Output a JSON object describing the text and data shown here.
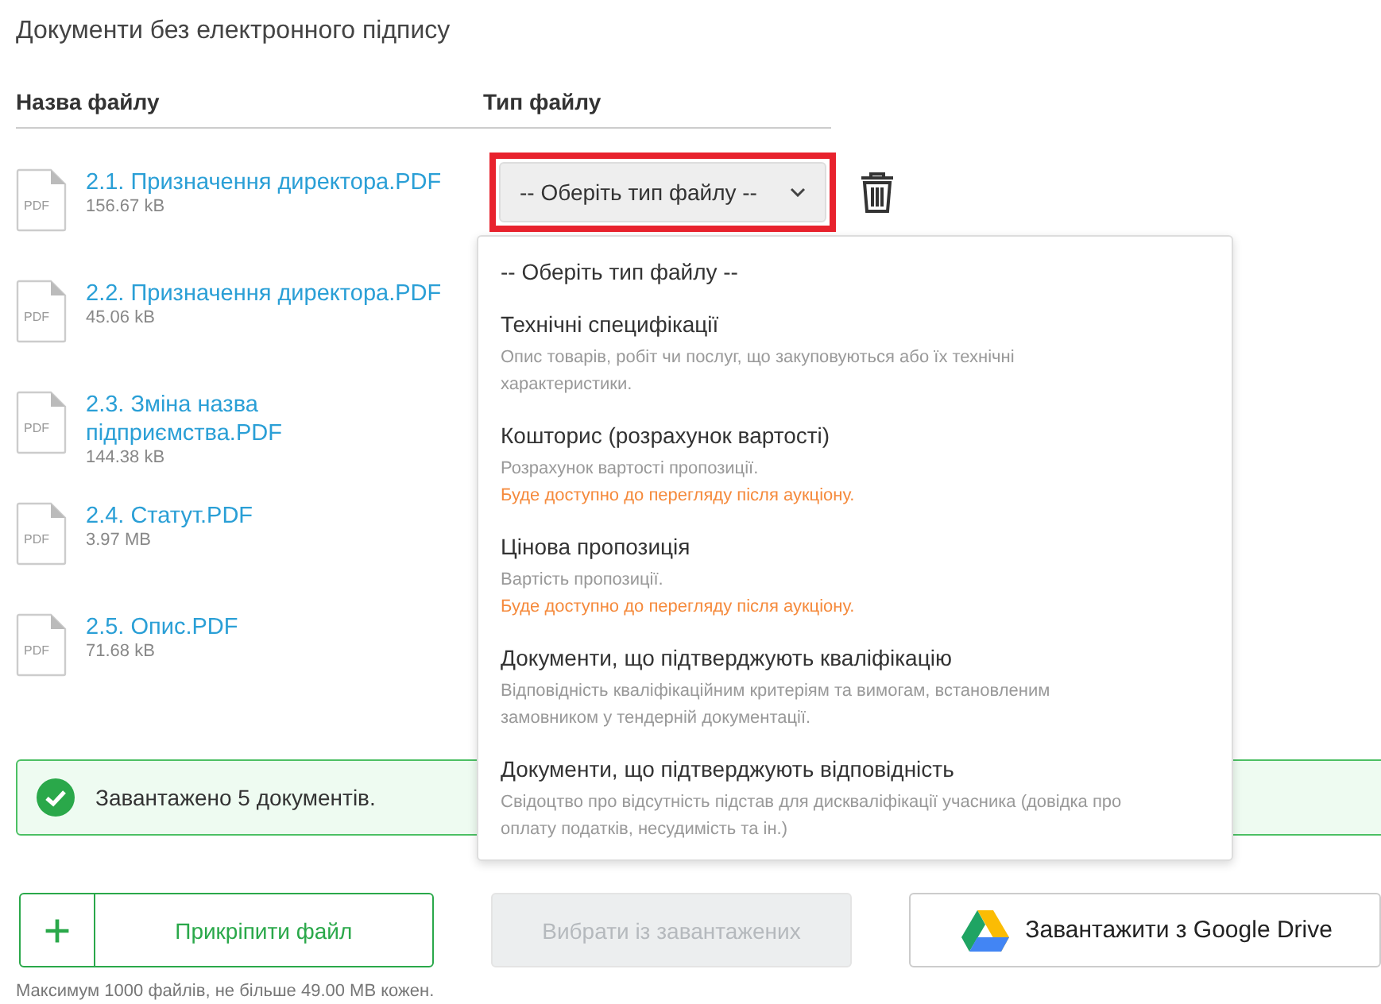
{
  "title": "Документи без електронного підпису",
  "columns": [
    "Назва файлу",
    "Тип файлу"
  ],
  "files": [
    {
      "icon_label": "PDF",
      "name": "2.1. Призначення директора.PDF",
      "size": "156.67 kB"
    },
    {
      "icon_label": "PDF",
      "name": "2.2. Призначення директора.PDF",
      "size": "45.06 kB"
    },
    {
      "icon_label": "PDF",
      "name": "2.3. Зміна назва підприємства.PDF",
      "size": "144.38 kB"
    },
    {
      "icon_label": "PDF",
      "name": "2.4. Статут.PDF",
      "size": "3.97 MB"
    },
    {
      "icon_label": "PDF",
      "name": "2.5. Опис.PDF",
      "size": "71.68 kB"
    }
  ],
  "file_type_select": {
    "value": "-- Оберіть тип файлу --",
    "highlighted": true,
    "expanded": true
  },
  "file_type_options": [
    {
      "label": "-- Оберіть тип файлу --"
    },
    {
      "label": "Технічні специфікації",
      "description": "Опис товарів, робіт чи послуг, що закуповуються або їх технічні характеристики."
    },
    {
      "label": "Кошторис (розрахунок вартості)",
      "description": "Розрахунок вартості пропозиції.",
      "note": "Буде доступно до перегляду після аукціону."
    },
    {
      "label": "Цінова пропозиція",
      "description": "Вартість пропозиції.",
      "note": "Буде доступно до перегляду після аукціону."
    },
    {
      "label": "Документи, що підтверджують кваліфікацію",
      "description": "Відповідність кваліфікаційним критеріям та вимогам, встановленим замовником у тендерній документації."
    },
    {
      "label": "Документи, що підтверджують відповідність",
      "description": "Свідоцтво про відсутність підстав для дискваліфікації учасника (довідка про оплату податків, несудимість та ін.)"
    }
  ],
  "alert": {
    "text": "Завантажено 5 документів."
  },
  "buttons": [
    {
      "kind": "attach",
      "label": "Прикріпити файл"
    },
    {
      "kind": "choose",
      "label": "Вибрати із завантажених",
      "disabled": true
    },
    {
      "kind": "drive",
      "label": "Завантажити з Google Drive"
    }
  ],
  "hint": "Максимум 1000 файлів, не більше 49.00 MB кожен."
}
